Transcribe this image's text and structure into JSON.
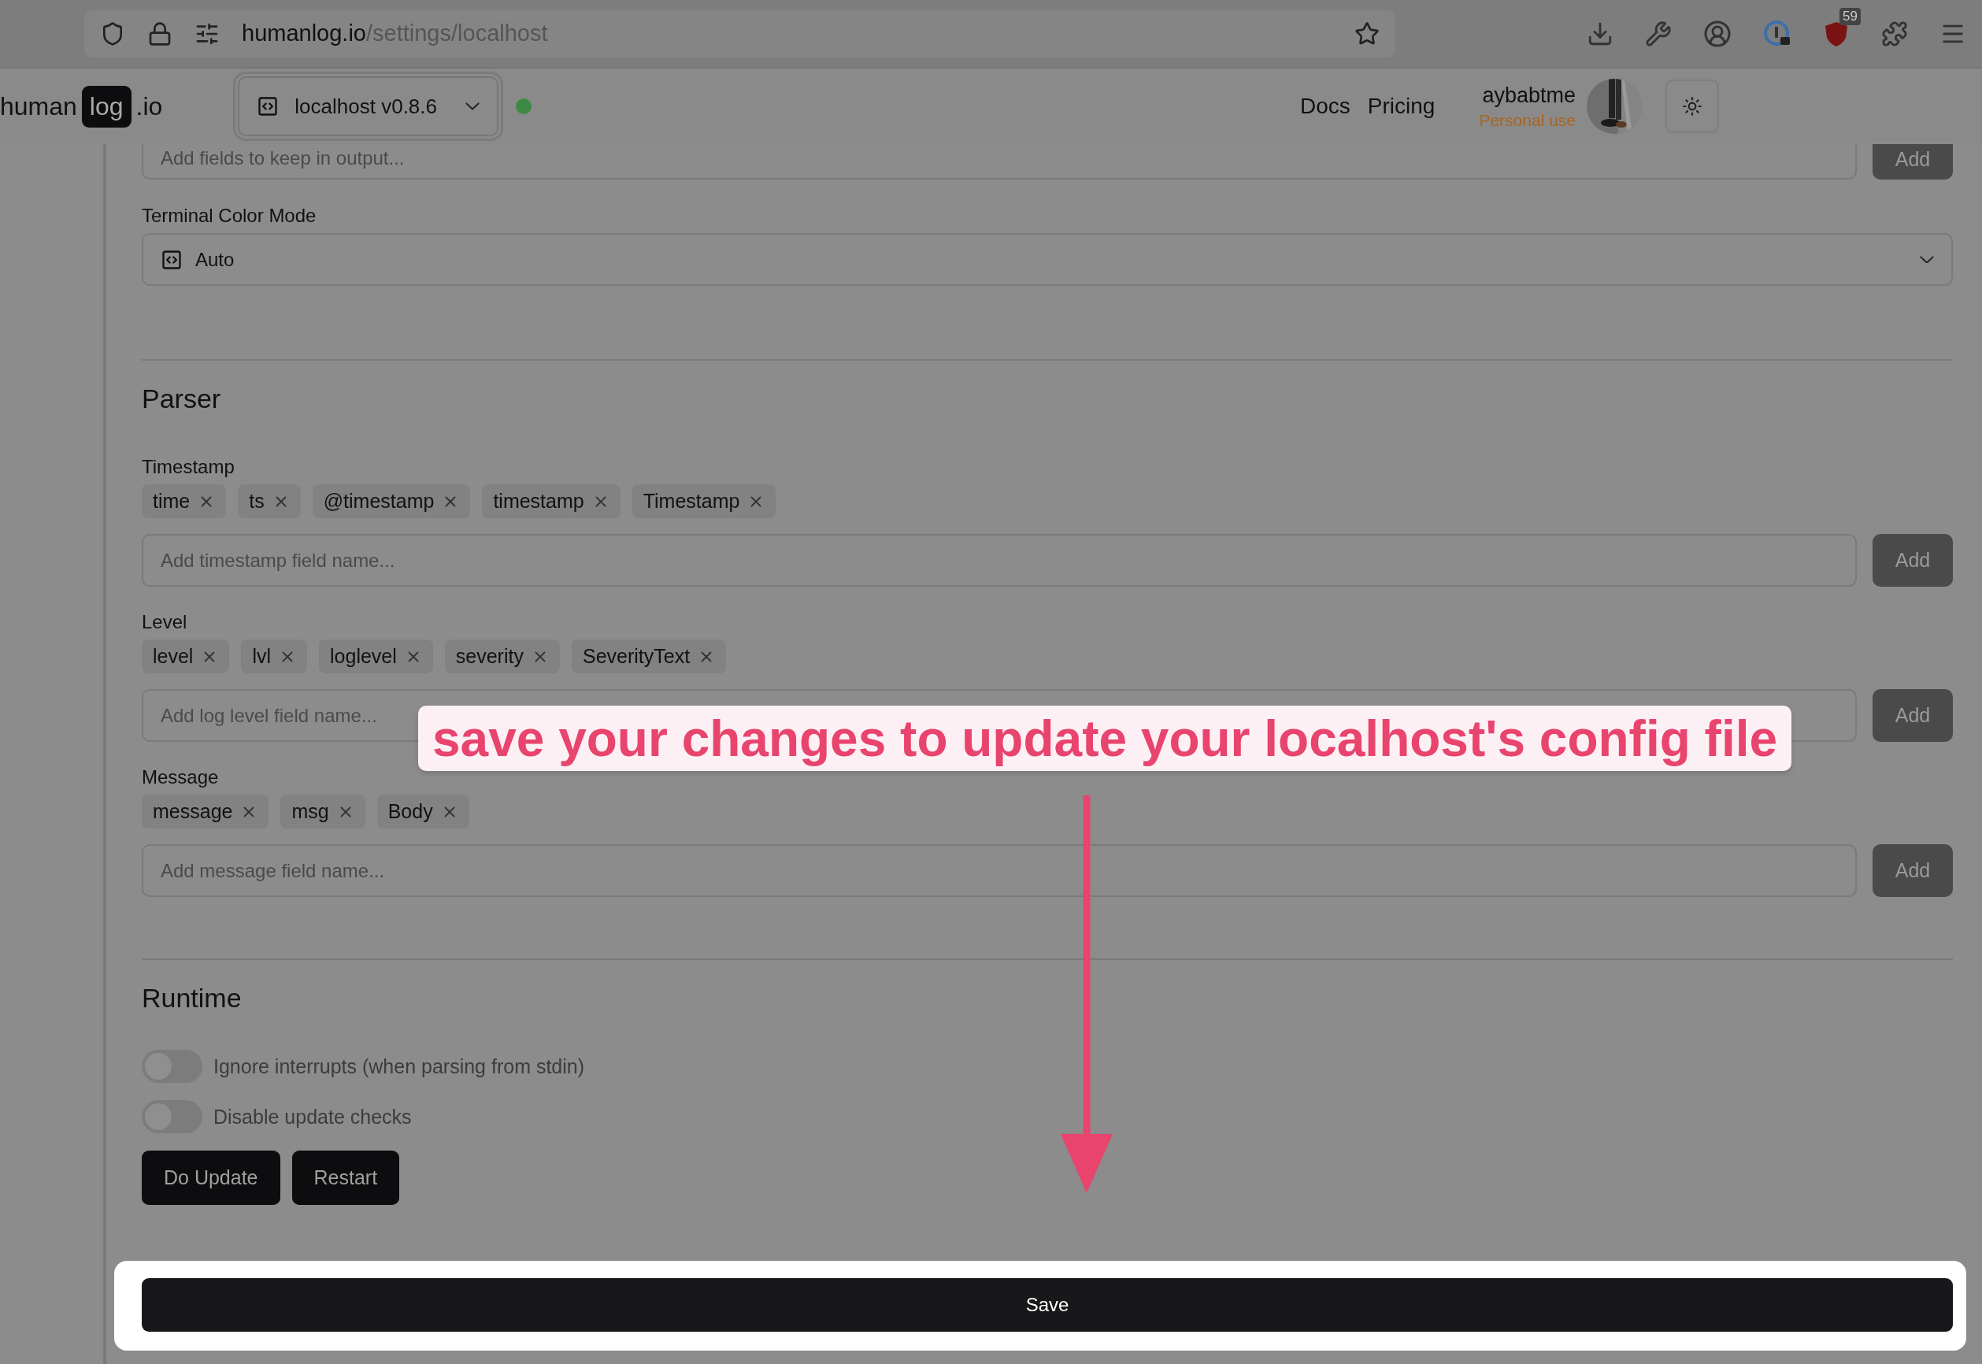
{
  "browser": {
    "url_host": "humanlog.io",
    "url_path": "/settings/localhost",
    "extension_badge": "59"
  },
  "header": {
    "logo": {
      "before": "human",
      "mark": "log",
      "after": ".io"
    },
    "instance": "localhost v0.8.6",
    "online": true,
    "nav": [
      "Docs",
      "Pricing"
    ],
    "user": {
      "name": "aybabtme",
      "plan": "Personal use"
    }
  },
  "output_fields": {
    "placeholder": "Add fields to keep in output...",
    "button": "Add"
  },
  "terminal_color_mode": {
    "label": "Terminal Color Mode",
    "value": "Auto"
  },
  "parser": {
    "title": "Parser",
    "groups": [
      {
        "label": "Timestamp",
        "chips": [
          "time",
          "ts",
          "@timestamp",
          "timestamp",
          "Timestamp"
        ],
        "placeholder": "Add timestamp field name...",
        "button": "Add"
      },
      {
        "label": "Level",
        "chips": [
          "level",
          "lvl",
          "loglevel",
          "severity",
          "SeverityText"
        ],
        "placeholder": "Add log level field name...",
        "button": "Add"
      },
      {
        "label": "Message",
        "chips": [
          "message",
          "msg",
          "Body"
        ],
        "placeholder": "Add message field name...",
        "button": "Add"
      }
    ]
  },
  "runtime": {
    "title": "Runtime",
    "toggles": [
      {
        "label": "Ignore interrupts (when parsing from stdin)",
        "on": false
      },
      {
        "label": "Disable update checks",
        "on": false
      }
    ],
    "buttons": [
      "Do Update",
      "Restart"
    ]
  },
  "save": {
    "label": "Save",
    "highlighted": true
  },
  "annotation": {
    "text": "save your changes to update your localhost's config file"
  }
}
